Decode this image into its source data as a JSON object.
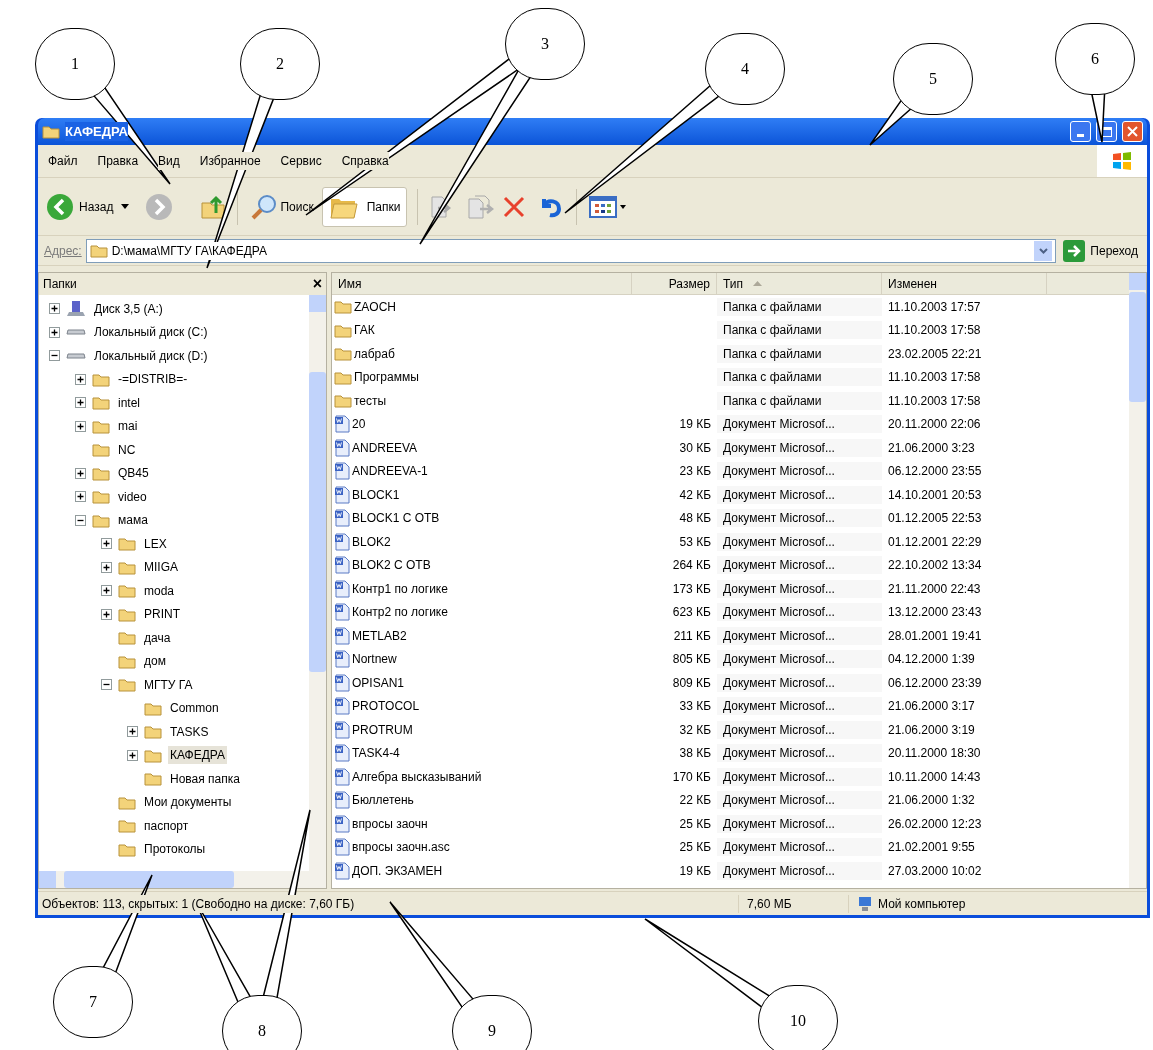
{
  "window": {
    "title": "КАФЕДРА"
  },
  "menu": [
    "Файл",
    "Правка",
    "Вид",
    "Избранное",
    "Сервис",
    "Справка"
  ],
  "toolbar": {
    "back": "Назад",
    "search": "Поиск",
    "folders": {
      "label": "Папки",
      "selected": true
    },
    "forward_disabled": true
  },
  "address": {
    "label": "Адрес:",
    "value": "D:\\мама\\МГТУ ГА\\КАФЕДРА",
    "go": "Переход"
  },
  "folders_pane": {
    "title": "Папки",
    "close": "×",
    "tree": [
      {
        "label": "Диск 3,5 (A:)",
        "kind": "floppy",
        "expanded": false,
        "selected": false
      },
      {
        "label": "Локальный диск (C:)",
        "kind": "drive",
        "expanded": false,
        "selected": false
      },
      {
        "label": "Локальный диск (D:)",
        "kind": "drive",
        "expanded": true,
        "selected": false,
        "children": [
          {
            "label": "-=DISTRIB=-",
            "kind": "folder",
            "expanded": false,
            "selected": false
          },
          {
            "label": "intel",
            "kind": "folder",
            "expanded": false,
            "selected": false
          },
          {
            "label": "mai",
            "kind": "folder",
            "expanded": false,
            "selected": false
          },
          {
            "label": "NC",
            "kind": "folder",
            "selected": false
          },
          {
            "label": "QB45",
            "kind": "folder",
            "expanded": false,
            "selected": false
          },
          {
            "label": "video",
            "kind": "folder",
            "expanded": false,
            "selected": false
          },
          {
            "label": "мама",
            "kind": "folder",
            "expanded": true,
            "selected": false,
            "children": [
              {
                "label": "LEX",
                "kind": "folder",
                "expanded": false,
                "selected": false
              },
              {
                "label": "MIIGA",
                "kind": "folder",
                "expanded": false,
                "selected": false
              },
              {
                "label": "moda",
                "kind": "folder",
                "expanded": false,
                "selected": false
              },
              {
                "label": "PRINT",
                "kind": "folder",
                "expanded": false,
                "selected": false
              },
              {
                "label": "дача",
                "kind": "folder",
                "selected": false
              },
              {
                "label": "дом",
                "kind": "folder",
                "selected": false
              },
              {
                "label": "МГТУ ГА",
                "kind": "folder",
                "expanded": true,
                "selected": false,
                "children": [
                  {
                    "label": "Common",
                    "kind": "folder",
                    "selected": false
                  },
                  {
                    "label": "TASKS",
                    "kind": "folder",
                    "expanded": false,
                    "selected": false
                  },
                  {
                    "label": "КАФЕДРА",
                    "kind": "folder",
                    "expanded": false,
                    "selected": true
                  },
                  {
                    "label": "Новая папка",
                    "kind": "folder",
                    "selected": false
                  }
                ]
              },
              {
                "label": "Мои документы",
                "kind": "folder",
                "selected": false
              },
              {
                "label": "паспорт",
                "kind": "folder",
                "selected": false
              },
              {
                "label": "Протоколы",
                "kind": "folder",
                "selected": false
              }
            ]
          }
        ]
      }
    ]
  },
  "table": {
    "columns": [
      {
        "label": "Имя",
        "sorted": false
      },
      {
        "label": "Размер",
        "sorted": false
      },
      {
        "label": "Тип",
        "sorted": true
      },
      {
        "label": "Изменен",
        "sorted": false
      }
    ],
    "rows": [
      {
        "kind": "folder",
        "name": "ZAOCH",
        "size": "",
        "type": "Папка с файлами",
        "modified": "11.10.2003 17:57"
      },
      {
        "kind": "folder",
        "name": "ГАК",
        "size": "",
        "type": "Папка с файлами",
        "modified": "11.10.2003 17:58"
      },
      {
        "kind": "folder",
        "name": "лабраб",
        "size": "",
        "type": "Папка с файлами",
        "modified": "23.02.2005 22:21"
      },
      {
        "kind": "folder",
        "name": "Программы",
        "size": "",
        "type": "Папка с файлами",
        "modified": "11.10.2003 17:58"
      },
      {
        "kind": "folder",
        "name": "тесты",
        "size": "",
        "type": "Папка с файлами",
        "modified": "11.10.2003 17:58"
      },
      {
        "kind": "document",
        "name": "20",
        "size": "19 КБ",
        "type": "Документ Microsof...",
        "modified": "20.11.2000 22:06"
      },
      {
        "kind": "document",
        "name": "ANDREEVA",
        "size": "30 КБ",
        "type": "Документ Microsof...",
        "modified": "21.06.2000 3:23"
      },
      {
        "kind": "document",
        "name": "ANDREEVA-1",
        "size": "23 КБ",
        "type": "Документ Microsof...",
        "modified": "06.12.2000 23:55"
      },
      {
        "kind": "document",
        "name": "BLOCK1",
        "size": "42 КБ",
        "type": "Документ Microsof...",
        "modified": "14.10.2001 20:53"
      },
      {
        "kind": "document",
        "name": "BLOCK1 C OTB",
        "size": "48 КБ",
        "type": "Документ Microsof...",
        "modified": "01.12.2005 22:53"
      },
      {
        "kind": "document",
        "name": "BLOK2",
        "size": "53 КБ",
        "type": "Документ Microsof...",
        "modified": "01.12.2001 22:29"
      },
      {
        "kind": "document",
        "name": "BLOK2 C OTB",
        "size": "264 КБ",
        "type": "Документ Microsof...",
        "modified": "22.10.2002 13:34"
      },
      {
        "kind": "document",
        "name": "Контр1 по логике",
        "size": "173 КБ",
        "type": "Документ Microsof...",
        "modified": "21.11.2000 22:43"
      },
      {
        "kind": "document",
        "name": "Контр2 по логике",
        "size": "623 КБ",
        "type": "Документ Microsof...",
        "modified": "13.12.2000 23:43"
      },
      {
        "kind": "document",
        "name": "METLAB2",
        "size": "211 КБ",
        "type": "Документ Microsof...",
        "modified": "28.01.2001 19:41"
      },
      {
        "kind": "document",
        "name": "Nortnew",
        "size": "805 КБ",
        "type": "Документ Microsof...",
        "modified": "04.12.2000 1:39"
      },
      {
        "kind": "document",
        "name": "OPISAN1",
        "size": "809 КБ",
        "type": "Документ Microsof...",
        "modified": "06.12.2000 23:39"
      },
      {
        "kind": "document",
        "name": "PROTOCOL",
        "size": "33 КБ",
        "type": "Документ Microsof...",
        "modified": "21.06.2000 3:17"
      },
      {
        "kind": "document",
        "name": "PROTRUM",
        "size": "32 КБ",
        "type": "Документ Microsof...",
        "modified": "21.06.2000 3:19"
      },
      {
        "kind": "document",
        "name": "TASK4-4",
        "size": "38 КБ",
        "type": "Документ Microsof...",
        "modified": "20.11.2000 18:30"
      },
      {
        "kind": "document",
        "name": "Алгебра высказываний",
        "size": "170 КБ",
        "type": "Документ Microsof...",
        "modified": "10.11.2000 14:43"
      },
      {
        "kind": "document",
        "name": "Бюллетень",
        "size": "22 КБ",
        "type": "Документ Microsof...",
        "modified": "21.06.2000 1:32"
      },
      {
        "kind": "document",
        "name": "впросы заочн",
        "size": "25 КБ",
        "type": "Документ Microsof...",
        "modified": "26.02.2000 12:23"
      },
      {
        "kind": "document",
        "name": "впросы заочн.asc",
        "size": "25 КБ",
        "type": "Документ Microsof...",
        "modified": "21.02.2001 9:55"
      },
      {
        "kind": "document",
        "name": "ДОП. ЭКЗАМЕН",
        "size": "19 КБ",
        "type": "Документ Microsof...",
        "modified": "27.03.2000 10:02"
      }
    ]
  },
  "status_bar": {
    "objects": "Объектов: 113, скрытых: 1 (Свободно на диске: 7,60 ГБ)",
    "size": "7,60 МБ",
    "location": "Мой компьютер"
  },
  "callouts": [
    "1",
    "2",
    "3",
    "4",
    "5",
    "6",
    "7",
    "8",
    "9",
    "10"
  ]
}
